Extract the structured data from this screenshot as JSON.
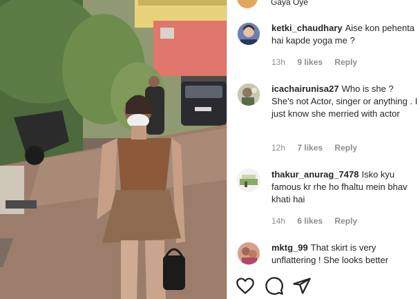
{
  "post": {
    "previous_comment_fragment": "Gaya Oye"
  },
  "comments": [
    {
      "username": "ketki_chaudhary",
      "text": "Aise kon pehenta hai kapde yoga me ?",
      "time": "13h",
      "likes": "9 likes",
      "reply": "Reply"
    },
    {
      "username": "icachairunisa27",
      "text": "Who is she ? She's not Actor, singer or anything . I just know she merried with actor",
      "time": "12h",
      "likes": "7 likes",
      "reply": "Reply"
    },
    {
      "username": "thakur_anurag_7478",
      "text": "Isko kyu famous kr rhe ho fhaltu mein bhav khati hai",
      "time": "14h",
      "likes": "6 likes",
      "reply": "Reply"
    },
    {
      "username": "mktg_99",
      "text": "That skirt is very unflattering ! She looks better",
      "time": "",
      "likes": "",
      "reply": ""
    }
  ],
  "actions": {
    "like_icon": "heart-icon",
    "comment_icon": "comment-icon",
    "share_icon": "send-icon"
  },
  "colors": {
    "text": "#262626",
    "meta": "#8e8e8e",
    "divider": "#dbdbdb"
  }
}
